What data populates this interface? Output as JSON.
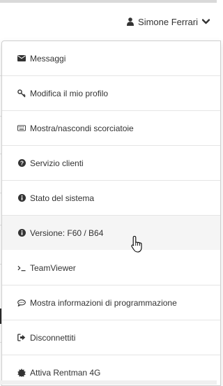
{
  "header": {
    "user_name": "Simone Ferrari",
    "user_icon": "user-icon",
    "toggle_icon": "chevron-down-icon"
  },
  "menu": {
    "items": [
      {
        "label": "Messaggi",
        "icon": "envelope-icon"
      },
      {
        "label": "Modifica il mio profilo",
        "icon": "key-icon"
      },
      {
        "label": "Mostra/nascondi scorciatoie",
        "icon": "keyboard-icon"
      },
      {
        "label": "Servizio clienti",
        "icon": "question-circle-icon"
      },
      {
        "label": "Stato del sistema",
        "icon": "info-circle-icon"
      },
      {
        "label": "Versione: F60 / B64",
        "icon": "info-circle-icon"
      },
      {
        "label": "TeamViewer",
        "icon": "terminal-icon"
      },
      {
        "label": "Mostra informazioni di programmazione",
        "icon": "comment-icon"
      },
      {
        "label": "Disconnettiti",
        "icon": "sign-out-icon"
      },
      {
        "label": "Attiva Rentman 4G",
        "icon": "certificate-icon"
      }
    ]
  },
  "colors": {
    "text": "#333333",
    "border": "#e5e5e5",
    "hover_bg": "#f5f5f5"
  }
}
